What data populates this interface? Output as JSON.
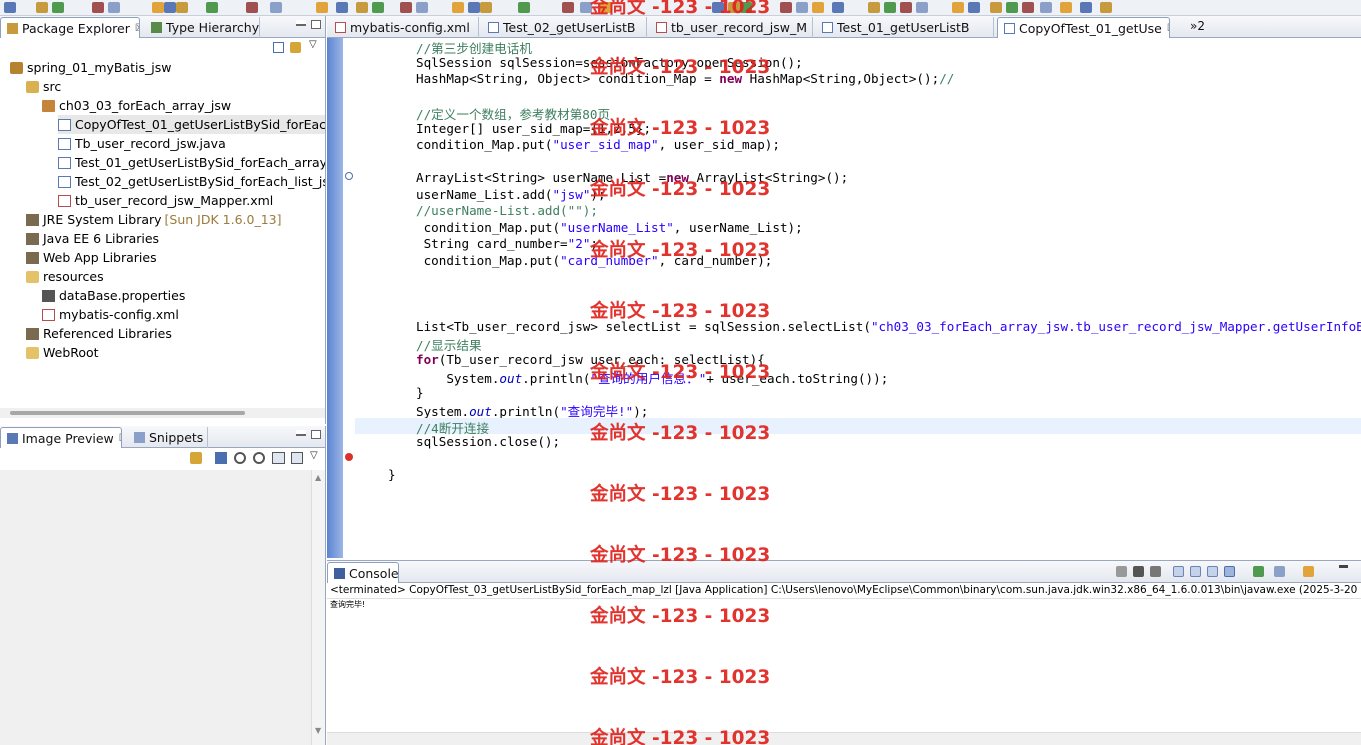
{
  "colors": {
    "keyword": "#7f0055",
    "string": "#2a00ff",
    "comment": "#3f7f5f",
    "field": "#0000c0",
    "watermark": "#e0231e",
    "selection": "#e8e8e8"
  },
  "watermark_text": "金尚文 -123 - 1023",
  "package_explorer": {
    "tabs": [
      {
        "label": "Package Explorer",
        "icon": "package-explorer-icon",
        "close": "☒"
      },
      {
        "label": "Type Hierarchy",
        "icon": "type-hierarchy-icon"
      }
    ],
    "tree": [
      {
        "label": "spring_01_myBatis_jsw",
        "icon": "java-project-icon"
      },
      {
        "label": "src",
        "icon": "source-folder-icon"
      },
      {
        "label": "ch03_03_forEach_array_jsw",
        "icon": "package-icon"
      },
      {
        "label": "CopyOfTest_01_getUserListBySid_forEach",
        "icon": "java-file-icon",
        "selected": true
      },
      {
        "label": "Tb_user_record_jsw.java",
        "icon": "java-file-icon"
      },
      {
        "label": "Test_01_getUserListBySid_forEach_array_j",
        "icon": "java-file-icon"
      },
      {
        "label": "Test_02_getUserListBySid_forEach_list_jsv",
        "icon": "java-file-icon"
      },
      {
        "label": "tb_user_record_jsw_Mapper.xml",
        "icon": "xml-file-icon"
      },
      {
        "label": "JRE System Library",
        "extra": "[Sun JDK 1.6.0_13]",
        "icon": "library-icon"
      },
      {
        "label": "Java EE 6 Libraries",
        "icon": "library-icon"
      },
      {
        "label": "Web App Libraries",
        "icon": "library-icon"
      },
      {
        "label": "resources",
        "icon": "folder-icon"
      },
      {
        "label": "dataBase.properties",
        "icon": "properties-file-icon"
      },
      {
        "label": "mybatis-config.xml",
        "icon": "xml-file-icon"
      },
      {
        "label": "Referenced Libraries",
        "icon": "library-icon"
      },
      {
        "label": "WebRoot",
        "icon": "folder-icon"
      }
    ]
  },
  "image_preview": {
    "tabs": [
      {
        "label": "Image Preview",
        "icon": "image-preview-icon",
        "close": "☒"
      },
      {
        "label": "Snippets",
        "icon": "snippets-icon"
      }
    ]
  },
  "editor": {
    "tabs": [
      {
        "label": "mybatis-config.xml",
        "icon": "xml-file-icon",
        "close": ""
      },
      {
        "label": "Test_02_getUserListB",
        "icon": "java-file-icon",
        "close": ""
      },
      {
        "label": "tb_user_record_jsw_M",
        "icon": "xml-file-icon",
        "close": ""
      },
      {
        "label": "Test_01_getUserListB",
        "icon": "java-file-icon",
        "close": ""
      },
      {
        "label": "CopyOfTest_01_getUse",
        "icon": "java-file-icon",
        "close": "☒",
        "active": true
      }
    ],
    "overflow_label": "»2",
    "lines": [
      [
        {
          "c": "cmt",
          "t": "//第三步创建电话机"
        }
      ],
      [
        {
          "t": "SqlSession sqlSession=sessionFactory.openSession();"
        }
      ],
      [
        {
          "t": "HashMap<String, Object> condition_Map = "
        },
        {
          "c": "kw",
          "t": "new"
        },
        {
          "t": " HashMap<String,Object>();"
        },
        {
          "c": "cmt",
          "t": "//"
        }
      ],
      [
        {
          "t": ""
        }
      ],
      [
        {
          "c": "cmt",
          "t": "//定义一个数组，参考教材第80页"
        }
      ],
      [
        {
          "t": "Integer[] user_sid_map={1,2,5};"
        }
      ],
      [
        {
          "t": "condition_Map.put("
        },
        {
          "c": "str",
          "t": "\"user_sid_map\""
        },
        {
          "t": ", user_sid_map);"
        }
      ],
      [
        {
          "t": ""
        }
      ],
      [
        {
          "t": "ArrayList<String> userName_List ="
        },
        {
          "c": "kw",
          "t": "new"
        },
        {
          "t": " ArrayList<String>();"
        }
      ],
      [
        {
          "t": "userName_List.add("
        },
        {
          "c": "str",
          "t": "\"jsw\""
        },
        {
          "t": ");"
        }
      ],
      [
        {
          "c": "cmt",
          "t": "//userName-List.add(\"\");"
        }
      ],
      [
        {
          "t": " condition_Map.put("
        },
        {
          "c": "str",
          "t": "\"userName_List\""
        },
        {
          "t": ", userName_List);"
        }
      ],
      [
        {
          "t": " String card_number="
        },
        {
          "c": "str",
          "t": "\"2\""
        },
        {
          "t": ";"
        }
      ],
      [
        {
          "t": " condition_Map.put("
        },
        {
          "c": "str",
          "t": "\"card_number\""
        },
        {
          "t": ", card_number);"
        }
      ],
      [
        {
          "t": ""
        }
      ],
      [
        {
          "t": ""
        }
      ],
      [
        {
          "t": ""
        }
      ],
      [
        {
          "t": "List<Tb_user_record_jsw> selectList = sqlSession.selectList("
        },
        {
          "c": "str",
          "t": "\"ch03_03_forEach_array_jsw.tb_user_record_jsw_Mapper.getUserInfoBySi"
        }
      ],
      [
        {
          "c": "cmt",
          "t": "//显示结果"
        }
      ],
      [
        {
          "c": "kw",
          "t": "for"
        },
        {
          "t": "(Tb_user_record_jsw user_each: selectList){"
        }
      ],
      [
        {
          "t": "    System."
        },
        {
          "c": "fld",
          "t": "out"
        },
        {
          "t": ".println("
        },
        {
          "c": "str",
          "t": "\"查询的用户信息：\""
        },
        {
          "t": "+ user_each.toString());"
        }
      ],
      [
        {
          "t": "}"
        }
      ],
      [
        {
          "t": "System."
        },
        {
          "c": "fld",
          "t": "out"
        },
        {
          "t": ".println("
        },
        {
          "c": "str",
          "t": "\"查询完毕!\""
        },
        {
          "t": ");"
        }
      ],
      [
        {
          "c": "cmt",
          "t": "//4断开连接"
        }
      ],
      [
        {
          "t": "sqlSession.close();"
        }
      ],
      [
        {
          "t": ""
        }
      ],
      [
        {
          "t": "}"
        }
      ]
    ]
  },
  "console": {
    "tab": {
      "label": "Console",
      "icon": "console-icon",
      "close": "☒"
    },
    "status": "<terminated> CopyOfTest_03_getUserListBySid_forEach_map_lzl [Java Application] C:\\Users\\lenovo\\MyEclipse\\Common\\binary\\com.sun.java.jdk.win32.x86_64_1.6.0.013\\bin\\javaw.exe (2025-3-20 下午2:58:51)",
    "output": "查询完毕!"
  }
}
